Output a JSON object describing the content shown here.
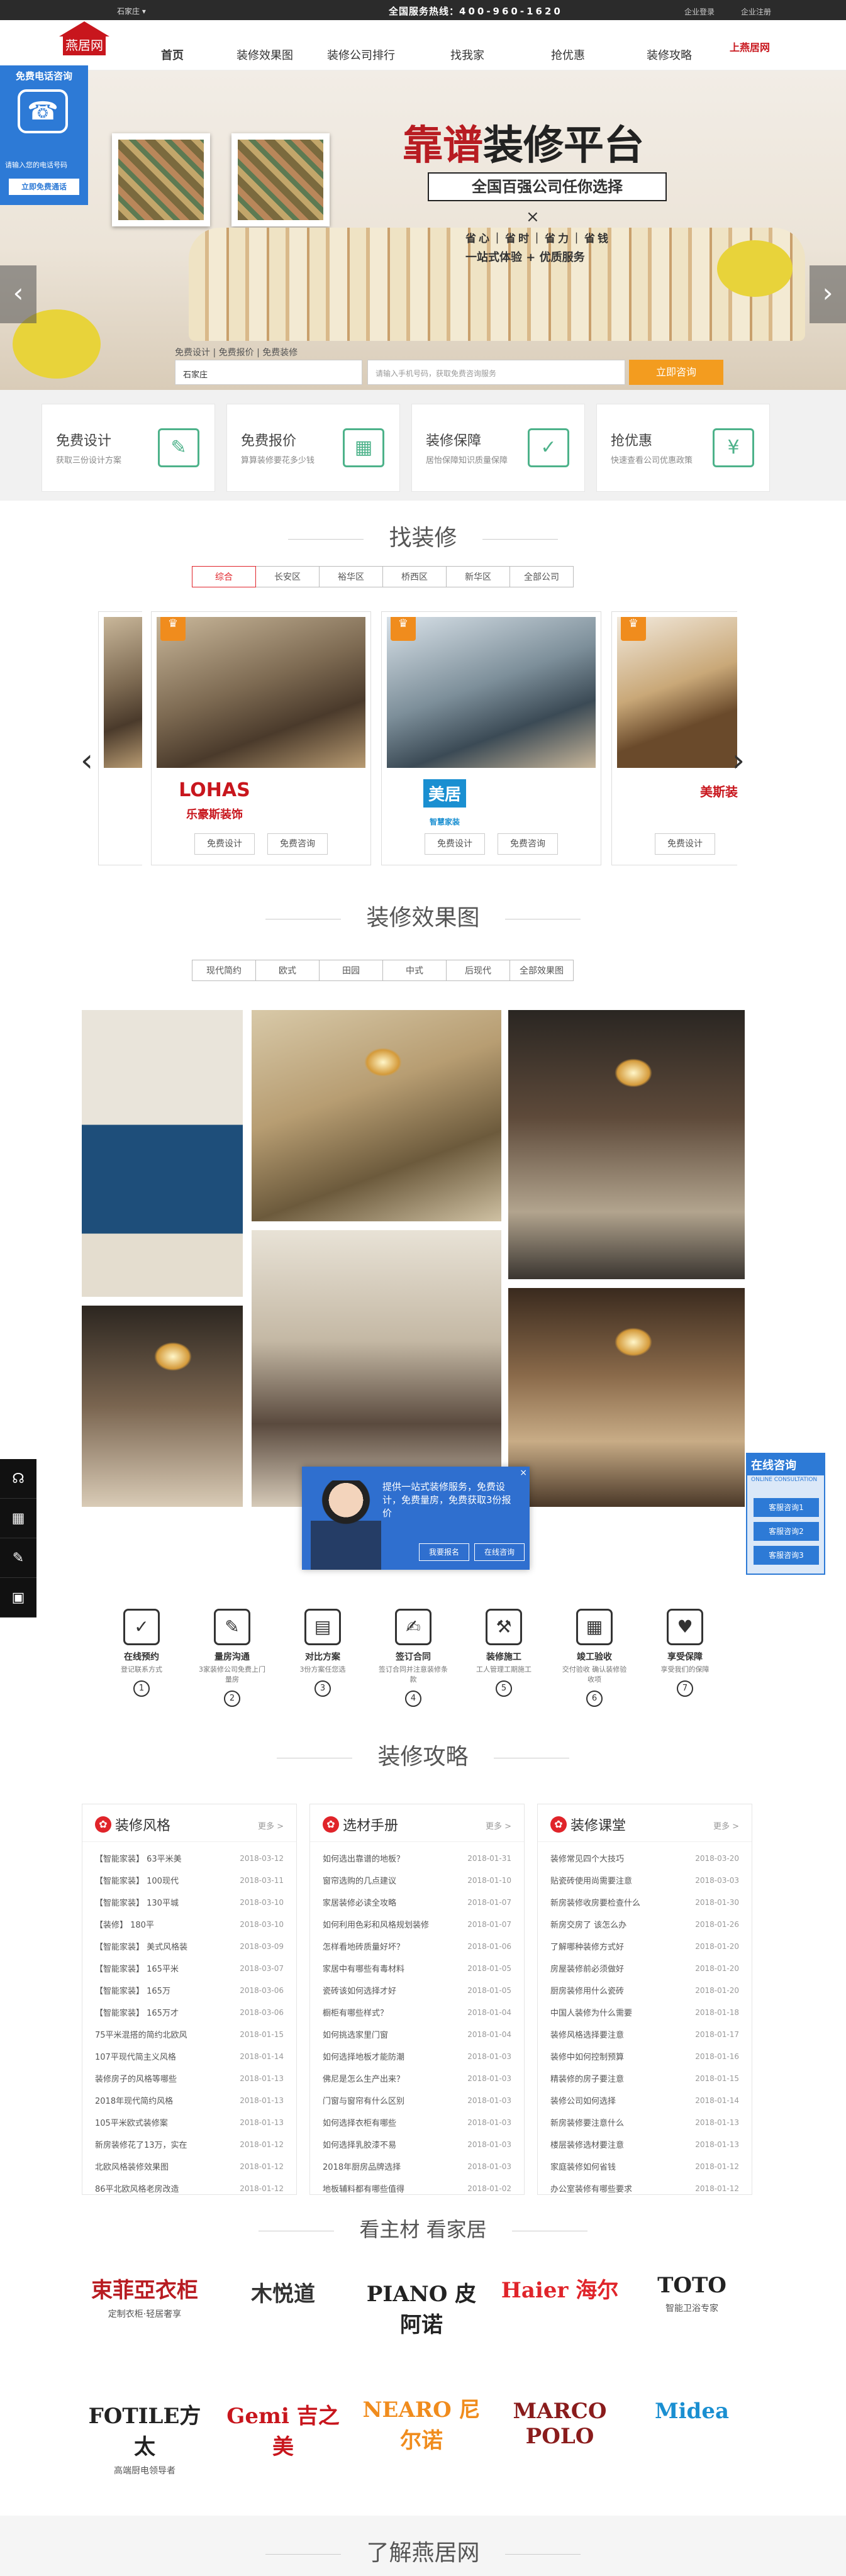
{
  "topbar": {
    "city": "石家庄 ▾",
    "hotline_label": "全国服务热线：",
    "hotline": "400-960-1620",
    "links": [
      "企业登录",
      "企业注册"
    ]
  },
  "brand": {
    "logo_text": "燕居网",
    "right_logo": "上燕居网"
  },
  "nav": {
    "items": [
      "首页",
      "装修效果图",
      "装修公司排行",
      "找我家",
      "抢优惠",
      "装修攻略"
    ]
  },
  "hero": {
    "title_red": "靠谱",
    "title_dark": "装修平台",
    "subtitle": "全国百强公司任你选择",
    "x": "×",
    "line2": "省心｜省时｜省力｜省钱",
    "line3": "一站式体验 + 优质服务"
  },
  "leftfloat": {
    "title": "免费电话咨询",
    "label": "请输入您的电话号码",
    "button": "立即免费通话"
  },
  "search": {
    "tabs": "免费设计 | 免费报价 | 免费装修",
    "select": "石家庄",
    "placeholder": "请输入手机号码，获取免费咨询服务",
    "button": "立即咨询"
  },
  "cards": [
    {
      "title": "免费设计",
      "desc": "获取三份设计方案",
      "icon": "✎"
    },
    {
      "title": "免费报价",
      "desc": "算算装修要花多少钱",
      "icon": "▦"
    },
    {
      "title": "装修保障",
      "desc": "居怡保障知识质量保障",
      "icon": "✓"
    },
    {
      "title": "抢优惠",
      "desc": "快速查看公司优惠政策",
      "icon": "¥"
    }
  ],
  "find": {
    "title": "找装修",
    "filters": [
      "综合",
      "长安区",
      "裕华区",
      "桥西区",
      "新华区",
      "全部公司"
    ]
  },
  "firms": [
    {
      "brand": "LOHAS",
      "brand_sub": "乐豪斯装饰",
      "color": "#c8161d",
      "btn1": "免费设计",
      "btn2": "免费咨询"
    },
    {
      "brand": "美居",
      "brand_sub": "智慧家装",
      "color": "#1a8fd1",
      "btn1": "免费设计",
      "btn2": "免费咨询"
    },
    {
      "brand": "美斯装",
      "brand_sub": "",
      "color": "#c8161d",
      "btn1": "免费设计",
      "btn2": "免费咨询"
    }
  ],
  "effects": {
    "title": "装修效果图",
    "filters": [
      "现代简约",
      "欧式",
      "田园",
      "中式",
      "后现代",
      "全部效果图"
    ]
  },
  "float": {
    "text": "提供一站式装修服务，免费设计，免费量房，免费获取3份报价",
    "btn1": "我要报名",
    "btn2": "在线咨询",
    "close": "×"
  },
  "online": {
    "title": "在线咨询",
    "sub": "ONLINE CONSULTATION",
    "buttons": [
      "客服咨询1",
      "客服咨询2",
      "客服咨询3"
    ]
  },
  "sidebar_icons": [
    "headset-icon",
    "calculator-icon",
    "edit-icon",
    "qrcode-icon"
  ],
  "flow": [
    {
      "t": "在线预约",
      "d": "登记联系方式",
      "i": "✓",
      "m": "1"
    },
    {
      "t": "量房沟通",
      "d": "3家装修公司免费上门量房",
      "i": "✎",
      "m": "2"
    },
    {
      "t": "对比方案",
      "d": "3份方案任您选",
      "i": "▤",
      "m": "3"
    },
    {
      "t": "签订合同",
      "d": "签订合同并注意装修条款",
      "i": "✍",
      "m": "4"
    },
    {
      "t": "装修施工",
      "d": "工人管理工期施工",
      "i": "⚒",
      "m": "5"
    },
    {
      "t": "竣工验收",
      "d": "交付验收 确认装修验收项",
      "i": "▦",
      "m": "6"
    },
    {
      "t": "享受保障",
      "d": "享受我们的保障",
      "i": "♥",
      "m": "7"
    }
  ],
  "guide": {
    "title": "装修攻略",
    "cols": [
      {
        "title": "装修风格",
        "more": "更多 >",
        "items": [
          [
            "【智能家装】 63平米美",
            "2018-03-12"
          ],
          [
            "【智能家装】 100现代",
            "2018-03-11"
          ],
          [
            "【智能家装】 130平城",
            "2018-03-10"
          ],
          [
            "【装修】 180平",
            "2018-03-10"
          ],
          [
            "【智能家装】 美式风格装",
            "2018-03-09"
          ],
          [
            "【智能家装】 165平米",
            "2018-03-07"
          ],
          [
            "【智能家装】 165万",
            "2018-03-06"
          ],
          [
            "【智能家装】 165万才",
            "2018-03-06"
          ],
          [
            "75平米混搭的简约北欧风",
            "2018-01-15"
          ],
          [
            "107平现代简主义风格",
            "2018-01-14"
          ],
          [
            "装修房子的风格等哪些",
            "2018-01-13"
          ],
          [
            "2018年现代简约风格",
            "2018-01-13"
          ],
          [
            "105平米欧式装修案",
            "2018-01-13"
          ],
          [
            "新房装修花了13万，实在",
            "2018-01-12"
          ],
          [
            "北欧风格装修效果图",
            "2018-01-12"
          ],
          [
            "86平北欧风格老房改造",
            "2018-01-12"
          ]
        ]
      },
      {
        "title": "选材手册",
        "more": "更多 >",
        "items": [
          [
            "如何选出靠谱的地板？",
            "2018-01-31"
          ],
          [
            "窗帘选购的几点建议",
            "2018-01-10"
          ],
          [
            "家居装修必读全攻略",
            "2018-01-07"
          ],
          [
            "如何利用色彩和风格规划装修",
            "2018-01-07"
          ],
          [
            "怎样看地砖质量好坏？",
            "2018-01-06"
          ],
          [
            "家居中有哪些有毒材料",
            "2018-01-05"
          ],
          [
            "瓷砖该如何选择才好",
            "2018-01-05"
          ],
          [
            "橱柜有哪些样式？",
            "2018-01-04"
          ],
          [
            "如何挑选家里门窗",
            "2018-01-04"
          ],
          [
            "如何选择地板才能防潮",
            "2018-01-03"
          ],
          [
            "佛尼是怎么生产出来？",
            "2018-01-03"
          ],
          [
            "门窗与窗帘有什么区别",
            "2018-01-03"
          ],
          [
            "如何选择衣柜有哪些",
            "2018-01-03"
          ],
          [
            "如何选择乳胶漆不易",
            "2018-01-03"
          ],
          [
            "2018年厨房品牌选择",
            "2018-01-03"
          ],
          [
            "地板辅料都有哪些值得",
            "2018-01-02"
          ]
        ]
      },
      {
        "title": "装修课堂",
        "more": "更多 >",
        "items": [
          [
            "装修常见四个大技巧",
            "2018-03-20"
          ],
          [
            "贴瓷砖使用尚需要注意",
            "2018-03-03"
          ],
          [
            "新房装修收房要检查什么",
            "2018-01-30"
          ],
          [
            "新房交房了 该怎么办",
            "2018-01-26"
          ],
          [
            "了解哪种装修方式好",
            "2018-01-20"
          ],
          [
            "房屋装修前必须做好",
            "2018-01-20"
          ],
          [
            "厨房装修用什么瓷砖",
            "2018-01-20"
          ],
          [
            "中国人装修为什么需要",
            "2018-01-18"
          ],
          [
            "装修风格选择要注意",
            "2018-01-17"
          ],
          [
            "装修中如何控制预算",
            "2018-01-16"
          ],
          [
            "精装修的房子要注意",
            "2018-01-15"
          ],
          [
            "装修公司如何选择",
            "2018-01-14"
          ],
          [
            "新房装修要注意什么",
            "2018-01-13"
          ],
          [
            "楼层装修选材要注意",
            "2018-01-13"
          ],
          [
            "家庭装修如何省钱",
            "2018-01-12"
          ],
          [
            "办公室装修有哪些要求",
            "2018-01-12"
          ]
        ]
      }
    ]
  },
  "brands_section": {
    "title": "看主材 看家居",
    "items": [
      {
        "name": "束菲亞衣柜",
        "sub": "定制衣柜·轻居奢享",
        "color": "#b81c22"
      },
      {
        "name": "木悦道",
        "sub": "",
        "color": "#333"
      },
      {
        "name": "PIANO 皮阿诺",
        "sub": "",
        "color": "#222"
      },
      {
        "name": "Haier 海尔",
        "sub": "",
        "color": "#e0242a"
      },
      {
        "name": "TOTO",
        "sub": "智能卫浴专家",
        "color": "#222"
      },
      {
        "name": "FOTILE方太",
        "sub": "高端厨电领导者",
        "color": "#222"
      },
      {
        "name": "Gemi 吉之美",
        "sub": "",
        "color": "#c8161d"
      },
      {
        "name": "NEARO 尼尔诺",
        "sub": "",
        "color": "#f08c1d"
      },
      {
        "name": "MARCO POLO",
        "sub": "",
        "color": "#8a1c1c"
      },
      {
        "name": "Midea",
        "sub": "",
        "color": "#1a8fd1"
      }
    ]
  },
  "about": {
    "title": "了解燕居网"
  }
}
